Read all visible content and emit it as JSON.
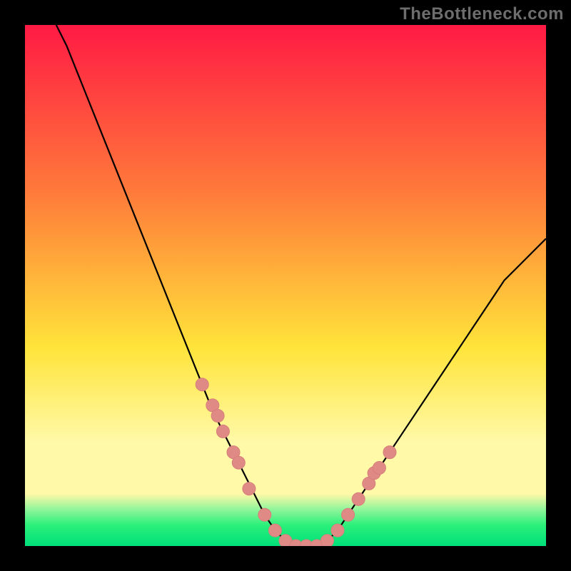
{
  "watermark": "TheBottleneck.com",
  "colors": {
    "bg_black": "#000000",
    "curve": "#000000",
    "marker_fill": "#e08a86",
    "marker_stroke": "#d67e7a",
    "grad_top": "#ff1a44",
    "grad_mid_top": "#ff7a3a",
    "grad_mid": "#ffe43a",
    "grad_band": "#fff9a8",
    "grad_green1": "#8ff59a",
    "grad_green2": "#2bf07a",
    "grad_green3": "#00e07a"
  },
  "chart_data": {
    "type": "line",
    "title": "",
    "xlabel": "",
    "ylabel": "",
    "xlim": [
      0,
      100
    ],
    "ylim": [
      0,
      100
    ],
    "grid": false,
    "series": [
      {
        "name": "bottleneck-curve",
        "x": [
          6,
          8,
          10,
          12,
          14,
          16,
          18,
          20,
          22,
          24,
          26,
          28,
          30,
          32,
          34,
          36,
          38,
          40,
          42,
          44,
          46,
          48,
          50,
          52,
          54,
          56,
          58,
          60,
          62,
          64,
          66,
          68,
          70,
          72,
          74,
          76,
          78,
          80,
          82,
          84,
          86,
          88,
          90,
          92,
          94,
          96,
          98,
          100
        ],
        "y": [
          100,
          96,
          91,
          86,
          81,
          76,
          71,
          66,
          61,
          56,
          51,
          46,
          41,
          36,
          31,
          26,
          22,
          18,
          14,
          10,
          6,
          3,
          1,
          0,
          0,
          0,
          1,
          3,
          6,
          9,
          12,
          15,
          18,
          21,
          24,
          27,
          30,
          33,
          36,
          39,
          42,
          45,
          48,
          51,
          53,
          55,
          57,
          59
        ]
      }
    ],
    "markers": {
      "name": "highlighted-points",
      "x": [
        34,
        36,
        37,
        38,
        40,
        41,
        43,
        46,
        48,
        50,
        52,
        54,
        56,
        58,
        60,
        62,
        64,
        66,
        67,
        68,
        70
      ],
      "y": [
        31,
        27,
        25,
        22,
        18,
        16,
        11,
        6,
        3,
        1,
        0,
        0,
        0,
        1,
        3,
        6,
        9,
        12,
        14,
        15,
        18
      ]
    }
  }
}
